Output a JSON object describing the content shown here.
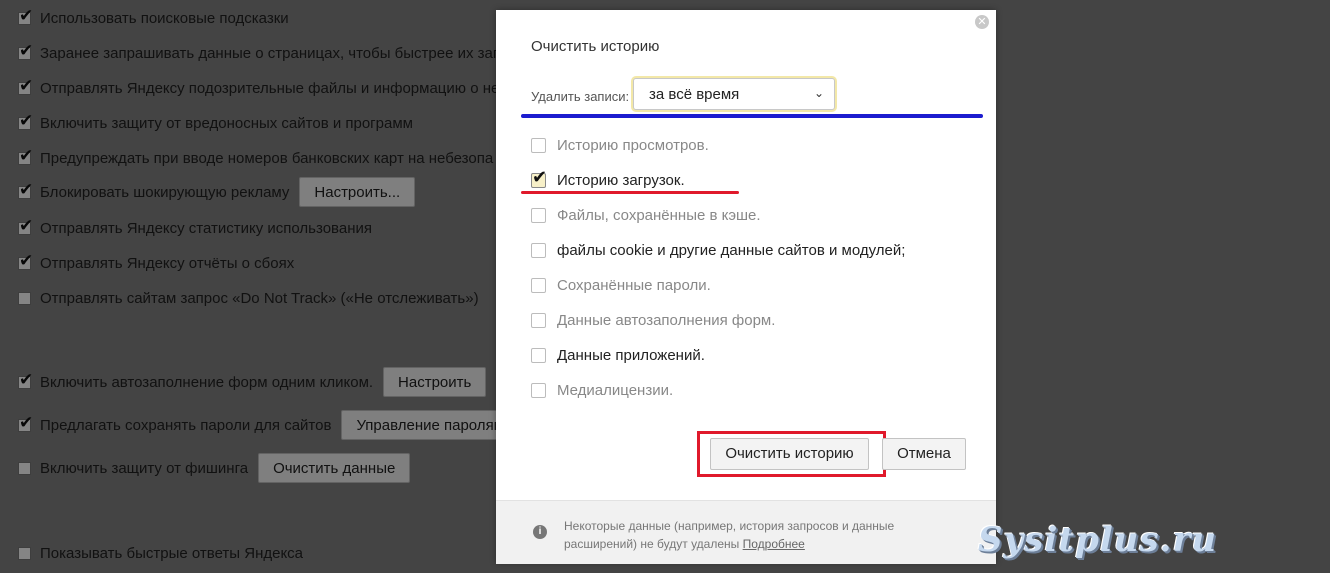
{
  "settings": {
    "items": [
      {
        "label": "Использовать поисковые подсказки",
        "checked": true
      },
      {
        "label": "Заранее запрашивать данные о страницах, чтобы быстрее их загр",
        "checked": true
      },
      {
        "label": "Отправлять Яндексу подозрительные файлы и информацию о неб",
        "checked": true
      },
      {
        "label": "Включить защиту от вредоносных сайтов и программ",
        "checked": true
      },
      {
        "label": "Предупреждать при вводе номеров банковских карт на небезопа",
        "checked": true
      },
      {
        "label": "Блокировать шокирующую рекламу",
        "checked": true,
        "button": "Настроить..."
      },
      {
        "label": "Отправлять Яндексу статистику использования",
        "checked": true
      },
      {
        "label": "Отправлять Яндексу отчёты о сбоях",
        "checked": true
      },
      {
        "label": "Отправлять сайтам запрос «Do Not Track» («Не отслеживать»)",
        "checked": false
      },
      {
        "label": "Включить автозаполнение форм одним кликом.",
        "checked": true,
        "button": "Настроить"
      },
      {
        "label": "Предлагать сохранять пароли для сайтов",
        "checked": true,
        "button": "Управление паролями"
      },
      {
        "label": "Включить защиту от фишинга",
        "checked": false,
        "button": "Очистить данные"
      },
      {
        "label": "Показывать быстрые ответы Яндекса",
        "checked": false
      }
    ]
  },
  "dialog": {
    "title": "Очистить историю",
    "close_icon": "close-icon",
    "delete_label": "Удалить записи:",
    "period_value": "за всё время",
    "options": [
      {
        "label": "Историю просмотров.",
        "checked": false
      },
      {
        "label": "Историю загрузок.",
        "checked": true
      },
      {
        "label": "Файлы, сохранённые в кэше.",
        "checked": false
      },
      {
        "label": "файлы cookie и другие данные сайтов и модулей;",
        "checked": false
      },
      {
        "label": "Сохранённые пароли.",
        "checked": false
      },
      {
        "label": "Данные автозаполнения форм.",
        "checked": false
      },
      {
        "label": "Данные приложений.",
        "checked": false
      },
      {
        "label": "Медиалицензии.",
        "checked": false
      }
    ],
    "clear_button": "Очистить историю",
    "cancel_button": "Отмена",
    "footer_text": "Некоторые данные (например, история запросов и данные расширений) не будут удалены",
    "footer_link": "Подробнее",
    "info_icon": "i"
  },
  "colors": {
    "highlight_blue": "#1c1ccf",
    "highlight_red": "#e0192b"
  },
  "watermark": "Sysitplus.ru"
}
